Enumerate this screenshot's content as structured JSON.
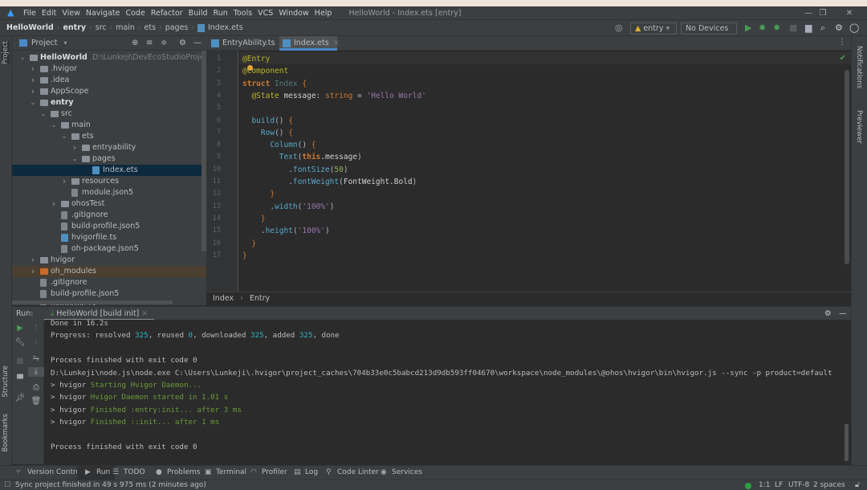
{
  "window": {
    "title": "HelloWorld - Index.ets [entry]"
  },
  "menu": [
    "File",
    "Edit",
    "View",
    "Navigate",
    "Code",
    "Refactor",
    "Build",
    "Run",
    "Tools",
    "VCS",
    "Window",
    "Help"
  ],
  "breadcrumb": [
    "HelloWorld",
    "entry",
    "src",
    "main",
    "ets",
    "pages",
    "Index.ets"
  ],
  "toolbar": {
    "module": "entry",
    "device": "No Devices"
  },
  "project": {
    "header": "Project",
    "tree": [
      {
        "label": "HelloWorld",
        "level": 0,
        "type": "module",
        "expanded": true,
        "bold": true,
        "path": "D:\\Lunkeji\\DevEcoStudioProjects\\HelloWorld"
      },
      {
        "label": ".hvigor",
        "level": 1,
        "type": "folder",
        "expanded": false
      },
      {
        "label": ".idea",
        "level": 1,
        "type": "folder",
        "expanded": false
      },
      {
        "label": "AppScope",
        "level": 1,
        "type": "folder",
        "expanded": false
      },
      {
        "label": "entry",
        "level": 1,
        "type": "module",
        "expanded": true,
        "bold": true
      },
      {
        "label": "src",
        "level": 2,
        "type": "folder",
        "expanded": true
      },
      {
        "label": "main",
        "level": 3,
        "type": "folder",
        "expanded": true
      },
      {
        "label": "ets",
        "level": 4,
        "type": "folder",
        "expanded": true
      },
      {
        "label": "entryability",
        "level": 5,
        "type": "folder",
        "expanded": false
      },
      {
        "label": "pages",
        "level": 5,
        "type": "folder",
        "expanded": true
      },
      {
        "label": "Index.ets",
        "level": 6,
        "type": "ets",
        "selected": true
      },
      {
        "label": "resources",
        "level": 4,
        "type": "folder",
        "expanded": false
      },
      {
        "label": "module.json5",
        "level": 4,
        "type": "file"
      },
      {
        "label": "ohosTest",
        "level": 3,
        "type": "folder",
        "expanded": false
      },
      {
        "label": ".gitignore",
        "level": 3,
        "type": "file"
      },
      {
        "label": "build-profile.json5",
        "level": 3,
        "type": "file"
      },
      {
        "label": "hvigorfile.ts",
        "level": 3,
        "type": "ets"
      },
      {
        "label": "oh-package.json5",
        "level": 3,
        "type": "file"
      },
      {
        "label": "hvigor",
        "level": 1,
        "type": "folder",
        "expanded": false
      },
      {
        "label": "oh_modules",
        "level": 1,
        "type": "excluded",
        "expanded": false
      },
      {
        "label": ".gitignore",
        "level": 1,
        "type": "file"
      },
      {
        "label": "build-profile.json5",
        "level": 1,
        "type": "file"
      },
      {
        "label": "hvigorfile.ts",
        "level": 1,
        "type": "file"
      }
    ]
  },
  "editor": {
    "tabs": [
      {
        "label": "EntryAbility.ts",
        "active": false
      },
      {
        "label": "Index.ets",
        "active": true
      }
    ],
    "lines": [
      [
        [
          "@Entry",
          "ann"
        ]
      ],
      [
        [
          "@Component",
          "ann"
        ]
      ],
      [
        [
          "struct ",
          "kw"
        ],
        [
          "Index ",
          "cls"
        ],
        [
          "{",
          "br"
        ]
      ],
      [
        [
          "  "
        ],
        [
          "@State ",
          "ann"
        ],
        [
          "message",
          "pl"
        ],
        [
          ": ",
          "op"
        ],
        [
          "string",
          "ty"
        ],
        [
          " = ",
          "op"
        ],
        [
          "'Hello World'",
          "str"
        ]
      ],
      [
        [
          ""
        ]
      ],
      [
        [
          "  "
        ],
        [
          "build",
          "fn"
        ],
        [
          "() ",
          "op"
        ],
        [
          "{",
          "br"
        ]
      ],
      [
        [
          "    "
        ],
        [
          "Row",
          "fn"
        ],
        [
          "() ",
          "op"
        ],
        [
          "{",
          "br"
        ]
      ],
      [
        [
          "      "
        ],
        [
          "Column",
          "fn"
        ],
        [
          "() ",
          "op"
        ],
        [
          "{",
          "br"
        ]
      ],
      [
        [
          "        "
        ],
        [
          "Text",
          "fn"
        ],
        [
          "(",
          "op"
        ],
        [
          "this",
          "kw"
        ],
        [
          ".message",
          "pl"
        ],
        [
          ")",
          "op"
        ]
      ],
      [
        [
          "          ."
        ],
        [
          "fontSize",
          "fn"
        ],
        [
          "(",
          "op"
        ],
        [
          "50",
          "num"
        ],
        [
          ")",
          "op"
        ]
      ],
      [
        [
          "          ."
        ],
        [
          "fontWeight",
          "fn"
        ],
        [
          "(",
          "op"
        ],
        [
          "FontWeight.Bold",
          "pl"
        ],
        [
          ")",
          "op"
        ]
      ],
      [
        [
          "      "
        ],
        [
          "}",
          "br"
        ]
      ],
      [
        [
          "      ."
        ],
        [
          "width",
          "fn"
        ],
        [
          "(",
          "op"
        ],
        [
          "'100%'",
          "str"
        ],
        [
          ")",
          "op"
        ]
      ],
      [
        [
          "    "
        ],
        [
          "}",
          "br"
        ]
      ],
      [
        [
          "    ."
        ],
        [
          "height",
          "fn"
        ],
        [
          "(",
          "op"
        ],
        [
          "'100%'",
          "str"
        ],
        [
          ")",
          "op"
        ]
      ],
      [
        [
          "  "
        ],
        [
          "}",
          "br"
        ]
      ],
      [
        [
          "}",
          "br"
        ]
      ]
    ],
    "crumbs": [
      "Index",
      "Entry"
    ]
  },
  "run": {
    "label": "Run:",
    "tab": "HelloWorld [build init]",
    "console": [
      [
        [
          "Done in 16.2s"
        ]
      ],
      [
        [
          "Progress: resolved "
        ],
        [
          "325",
          "num"
        ],
        [
          ", reused "
        ],
        [
          "0",
          "num"
        ],
        [
          ", downloaded "
        ],
        [
          "325",
          "num"
        ],
        [
          ", added "
        ],
        [
          "325",
          "num"
        ],
        [
          ", done"
        ]
      ],
      [
        [
          ""
        ]
      ],
      [
        [
          "Process finished with exit code 0"
        ]
      ],
      [
        [
          "D:\\Lunkeji\\node.js\\node.exe C:\\Users\\Lunkeji\\.hvigor\\project_caches\\704b33e0c5babcd213d9db593ff04670\\workspace\\node_modules\\@ohos\\hvigor\\bin\\hvigor.js --sync -p product=default"
        ]
      ],
      [
        [
          "> hvigor "
        ],
        [
          "Starting Hvigor Daemon...",
          "grn"
        ]
      ],
      [
        [
          "> hvigor "
        ],
        [
          "Hvigor Daemon started in 1.01 s",
          "grn"
        ]
      ],
      [
        [
          "> hvigor "
        ],
        [
          "Finished :entry:init... after 3 ms",
          "grn"
        ]
      ],
      [
        [
          "> hvigor "
        ],
        [
          "Finished ::init... after 1 ms",
          "grn"
        ]
      ],
      [
        [
          ""
        ]
      ],
      [
        [
          "Process finished with exit code 0"
        ]
      ]
    ]
  },
  "side": {
    "left_top": "Project",
    "left_structure": "Structure",
    "left_bookmarks": "Bookmarks",
    "right_notifications": "Notifications",
    "right_previewer": "Previewer"
  },
  "bottom_tabs": [
    {
      "label": "Version Control",
      "icon": "branch-icon",
      "glyph": "⑂"
    },
    {
      "label": "Run",
      "icon": "play-icon",
      "glyph": "▶",
      "active": true
    },
    {
      "label": "TODO",
      "icon": "list-icon",
      "glyph": "☰"
    },
    {
      "label": "Problems",
      "icon": "info-icon",
      "glyph": "●"
    },
    {
      "label": "Terminal",
      "icon": "terminal-icon",
      "glyph": "▣"
    },
    {
      "label": "Profiler",
      "icon": "gauge-icon",
      "glyph": "◠"
    },
    {
      "label": "Log",
      "icon": "log-icon",
      "glyph": "▤"
    },
    {
      "label": "Code Linter",
      "icon": "linter-icon",
      "glyph": "⚲"
    },
    {
      "label": "Services",
      "icon": "services-icon",
      "glyph": "◉"
    }
  ],
  "status": {
    "message": "Sync project finished in 49 s 975 ms (2 minutes ago)",
    "position": "1:1",
    "line_ending": "LF",
    "encoding": "UTF-8",
    "indent": "2 spaces"
  },
  "colors": {
    "accent": "#4a88c7",
    "run_green": "#499c54",
    "status_ok": "#2ea043"
  }
}
